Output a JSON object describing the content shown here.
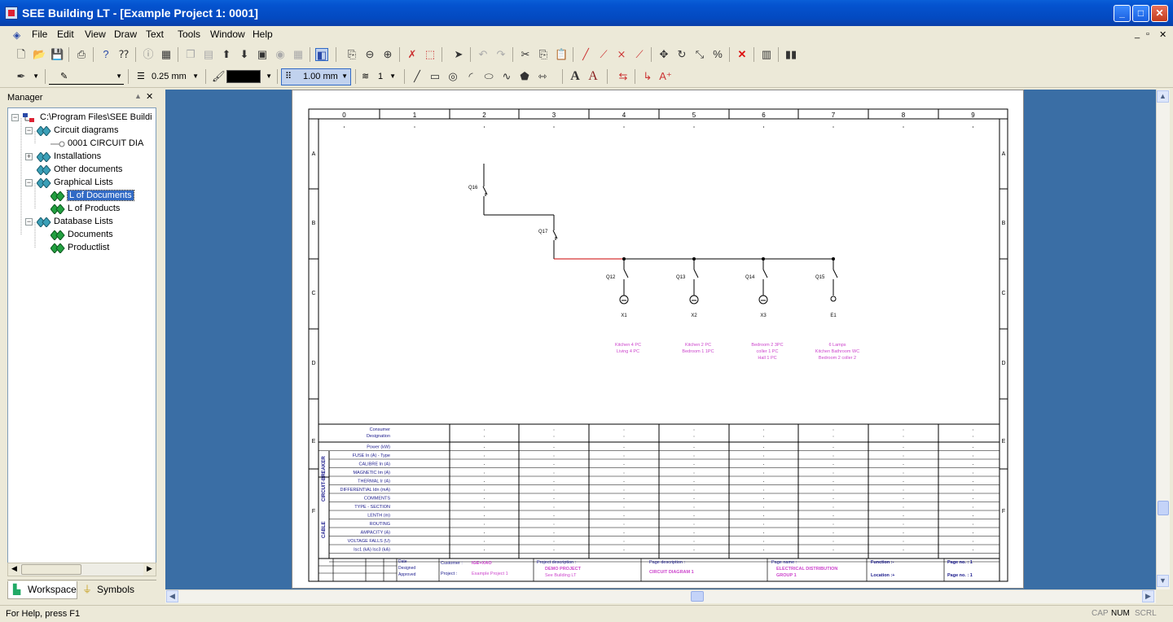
{
  "window": {
    "title": "SEE Building LT - [Example Project 1: 0001]",
    "minimize": "_",
    "maximize": "□",
    "close": "✕"
  },
  "menu": {
    "items": [
      "File",
      "Edit",
      "View",
      "Draw",
      "Text",
      "Tools",
      "Window",
      "Help"
    ],
    "mdi_controls": [
      "_",
      "▫",
      "✕"
    ]
  },
  "toolbar2": {
    "line_width": "0.25 mm",
    "grid": "1.00 mm",
    "layer": "1"
  },
  "manager": {
    "title": "Manager",
    "tree": [
      {
        "label": "C:\\Program Files\\SEE Buildi",
        "level": 0,
        "expander": "-",
        "icon": "folder-tree-icon"
      },
      {
        "label": "Circuit diagrams",
        "level": 1,
        "expander": "-",
        "icon": "double-diamond-icon"
      },
      {
        "label": "0001   CIRCUIT DIA",
        "level": 2,
        "expander": "",
        "icon": "key-icon"
      },
      {
        "label": "Installations",
        "level": 1,
        "expander": "+",
        "icon": "double-diamond-icon"
      },
      {
        "label": "Other documents",
        "level": 1,
        "expander": "",
        "icon": "double-diamond-icon"
      },
      {
        "label": "Graphical Lists",
        "level": 1,
        "expander": "-",
        "icon": "double-diamond-icon"
      },
      {
        "label": "L of Documents",
        "level": 2,
        "expander": "",
        "icon": "double-diamond-green-icon",
        "selected": true
      },
      {
        "label": "L of Products",
        "level": 2,
        "expander": "",
        "icon": "double-diamond-green-icon"
      },
      {
        "label": "Database Lists",
        "level": 1,
        "expander": "-",
        "icon": "double-diamond-icon"
      },
      {
        "label": "Documents",
        "level": 2,
        "expander": "",
        "icon": "double-diamond-green-icon"
      },
      {
        "label": "Productlist",
        "level": 2,
        "expander": "",
        "icon": "double-diamond-green-icon"
      }
    ],
    "tabs": [
      "Workspace",
      "Symbols"
    ]
  },
  "sheet": {
    "columns": [
      "0",
      "1",
      "2",
      "3",
      "4",
      "5",
      "6",
      "7",
      "8",
      "9"
    ],
    "rows": [
      "A",
      "B",
      "C",
      "D",
      "E",
      "F"
    ],
    "breakers": [
      "Q16",
      "Q17",
      "Q12",
      "Q13",
      "Q14",
      "Q15"
    ],
    "outputs": [
      "X1",
      "X2",
      "X3",
      "E1"
    ],
    "consumers": [
      [
        "Kitchen 4 PC",
        "Living 4 PC"
      ],
      [
        "Kitchen 2 PC",
        "Bedroom 1 1PC"
      ],
      [
        "Bedroom 2 3PC",
        "coller 1 PC",
        "Hall 1 PC"
      ],
      [
        "6 Lamps",
        "Kitchen Bathroom WC",
        "Bedroom 2 coller 2"
      ]
    ],
    "table_labels": [
      "Consumer",
      "Designation",
      "Power (kW)",
      "FUSE  In (A) - Type",
      "CALIBRE In (A)",
      "MAGNETIC Im (A)",
      "THERMAL Ir (A)",
      "DIFFERENTIAL Idn (mA)",
      "COMMENTS",
      "TYPE - SECTION",
      "LENTH (m)",
      "ROUTING",
      "AMPACITY (A)",
      "VOLTAGE FALLS (U)",
      "Isc1 (kA) Isc3 (kA)"
    ],
    "group_labels": [
      "CIRCUIT-BREAKER",
      "CABLE"
    ],
    "title_block": {
      "customer_label": "Customer :",
      "customer": "IGE+XAO",
      "project_label": "Project :",
      "project": "Example Project 1",
      "proj_desc_label": "Project description :",
      "proj_desc": "DEMO PROJECT",
      "proj_desc2": "See Building LT",
      "page_desc_label": "Page description :",
      "page_desc": "CIRCUIT DIAGRAM 1",
      "page_name_label": "Page name :",
      "page_name": "ELECTRICAL DISTRIBUTION",
      "page_name2": "GROUP 1",
      "function": "Function :-",
      "location": "Location :+",
      "page_no": "Page no. : 1",
      "page_count": "Page no. : 1",
      "date_label": "Date",
      "designed_label": "Designed",
      "approved_label": "Approved"
    }
  },
  "status": {
    "help": "For Help, press F1",
    "indicators": [
      {
        "label": "CAP",
        "on": false
      },
      {
        "label": "NUM",
        "on": true
      },
      {
        "label": "SCRL",
        "on": false
      }
    ]
  },
  "colors": {
    "titlebar": "#0453cf",
    "workspace_bg": "#3a6ea5",
    "selection": "#316ac5",
    "annotation": "#cc44cc",
    "wire_red": "#cc0000"
  }
}
